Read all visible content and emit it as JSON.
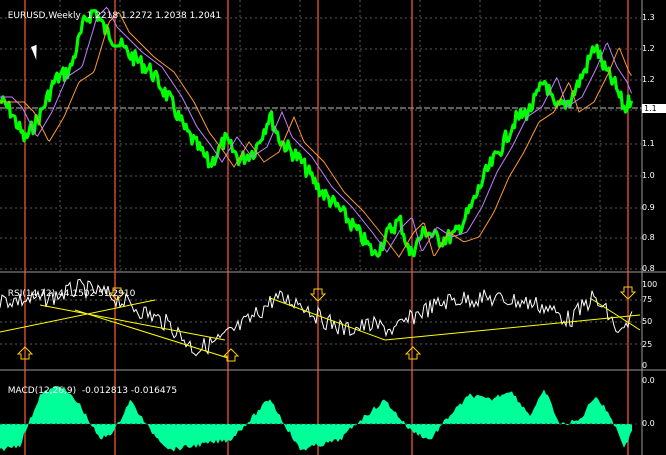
{
  "main_panel": {
    "symbol_label": "EURUSD,Weekly",
    "ohlc_label": "1.2218 1.2272 1.2038 1.2041",
    "axis_ticks": [
      "1.3",
      "1.2",
      "1.2",
      "1.1",
      "1.1",
      "1.0",
      "0.9",
      "0.9",
      "0.8",
      "0.8"
    ],
    "current_price_tag": "1.1"
  },
  "rsi_panel": {
    "label": "RSI(14,72)",
    "values_label": "44.1502 51.2910",
    "axis_ticks": [
      "100",
      "75",
      "50",
      "25",
      "0"
    ]
  },
  "macd_panel": {
    "label": "MACD(12,26,9)",
    "values_label": "-0.012813 -0.016475",
    "axis_ticks": [
      "0.0",
      "0.0"
    ]
  },
  "colors": {
    "background": "#000000",
    "price_line": "#00ff00",
    "ma_fast": "#c080ff",
    "ma_slow": "#ff9933",
    "rsi_line": "#ffffff",
    "trendline": "#ffff00",
    "vertical_marker": "#ff5a3c",
    "grid": "#5a5a5a",
    "macd_histogram": "#00ff99",
    "arrow": "#ffcc00"
  },
  "icons": {
    "arrows": [
      "down-arrow-icon",
      "up-arrow-icon"
    ],
    "cursor": "mouse-pointer-icon"
  }
}
